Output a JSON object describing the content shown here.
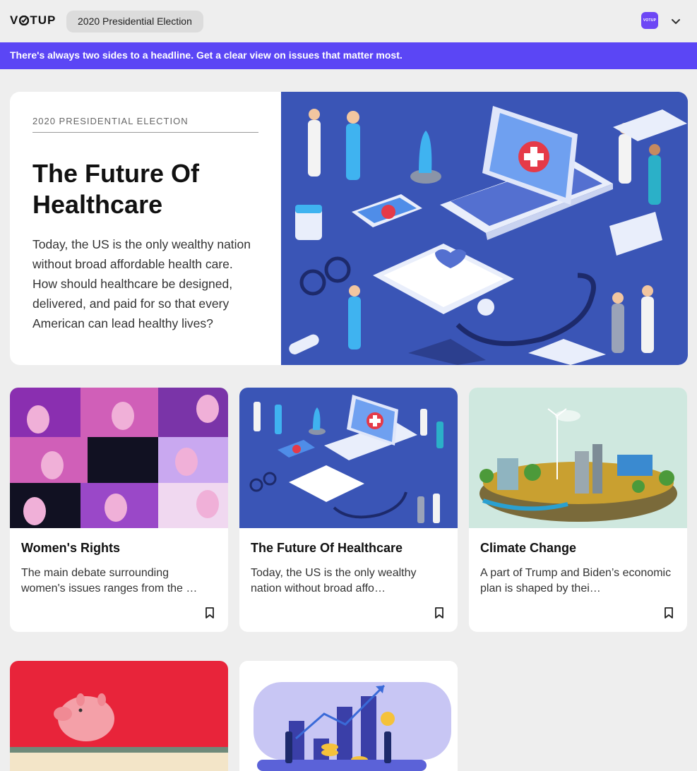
{
  "header": {
    "logo_text": "VOTUP",
    "section_chip": "2020 Presidential Election",
    "app_badge_text": "VOTUP",
    "menu_icon": "chevron-down-icon"
  },
  "banner": {
    "text": "There's always two sides to a headline. Get a clear view on issues that matter most."
  },
  "hero": {
    "kicker": "2020 PRESIDENTIAL ELECTION",
    "title": "The Future Of Healthcare",
    "description": "Today, the US is the only wealthy nation without broad affordable health care. How should healthcare be designed, delivered, and paid for so that every American can lead healthy lives?"
  },
  "cards": [
    {
      "title": "Women's Rights",
      "description": "The main debate surrounding women's issues ranges from the …",
      "icon": "bookmark-icon"
    },
    {
      "title": "The Future Of Healthcare",
      "description": "Today, the US is the only wealthy nation without broad affo…",
      "icon": "bookmark-icon"
    },
    {
      "title": "Climate Change",
      "description": "A part of Trump and Biden’s economic plan is shaped by thei…",
      "icon": "bookmark-icon"
    }
  ],
  "colors": {
    "accent": "#5b46f5",
    "background": "#eeeeee",
    "card": "#ffffff"
  }
}
